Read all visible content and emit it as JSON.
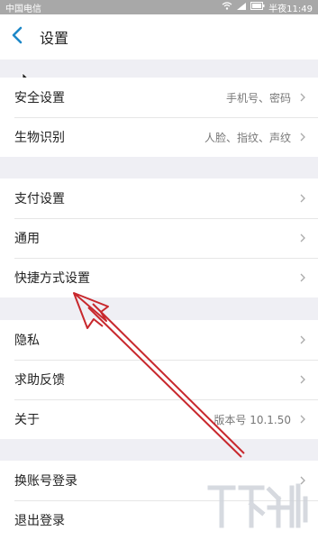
{
  "status_bar": {
    "carrier": "中国电信",
    "time": "半夜11:49"
  },
  "header": {
    "title": "设置"
  },
  "groups": [
    [
      {
        "label": "安全设置",
        "value": "手机号、密码"
      },
      {
        "label": "生物识别",
        "value": "人脸、指纹、声纹"
      }
    ],
    [
      {
        "label": "支付设置",
        "value": ""
      },
      {
        "label": "通用",
        "value": ""
      },
      {
        "label": "快捷方式设置",
        "value": ""
      }
    ],
    [
      {
        "label": "隐私",
        "value": ""
      },
      {
        "label": "求助反馈",
        "value": ""
      },
      {
        "label": "关于",
        "value": "版本号 10.1.50"
      }
    ],
    [
      {
        "label": "换账号登录",
        "value": ""
      },
      {
        "label": "退出登录",
        "value": ""
      }
    ]
  ],
  "colors": {
    "accent": "#1e88c8",
    "annotation": "#c8282d",
    "background": "#efeff4"
  }
}
